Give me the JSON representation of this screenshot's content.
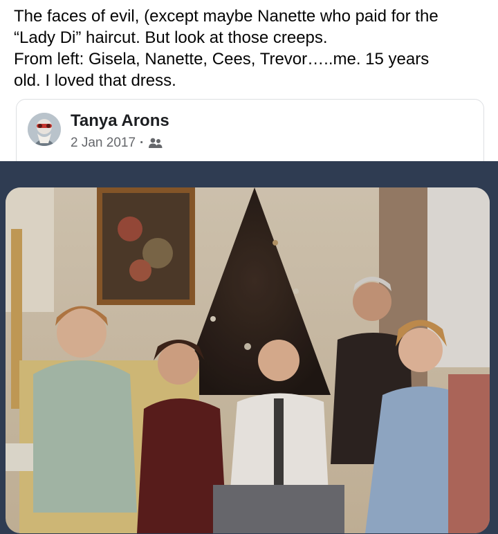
{
  "post": {
    "caption": "The faces of evil, (except maybe Nanette who paid for the\n“Lady Di” haircut.  But look at those creeps.\nFrom left:  Gisela, Nanette, Cees, Trevor…..me.  15 years\nold.  I loved that dress."
  },
  "shared_post": {
    "author": "Tanya Arons",
    "date": "2 Jan 2017",
    "separator": "·",
    "audience_icon": "friends-icon"
  },
  "photo": {
    "icon": "family-photo"
  }
}
